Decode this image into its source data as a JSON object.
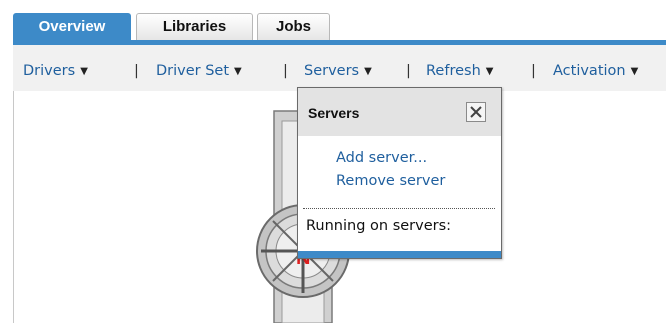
{
  "tabs": [
    {
      "label": "Overview"
    },
    {
      "label": "Libraries"
    },
    {
      "label": "Jobs"
    }
  ],
  "menu": {
    "drivers": "Drivers",
    "driver_set": "Driver Set",
    "servers": "Servers",
    "refresh": "Refresh",
    "activation": "Activation",
    "separator": "|",
    "caret": "▼"
  },
  "popup": {
    "title": "Servers",
    "add_server": "Add server...",
    "remove_server": "Remove server",
    "running_on": "Running on servers:"
  },
  "colors": {
    "accent": "#3d8ac8",
    "link": "#1f5f9e",
    "driver_set_icon": "#c8c8c8",
    "driver_set_letter": "#e02020"
  },
  "icons": [
    "close-icon",
    "driver-set-icon"
  ]
}
